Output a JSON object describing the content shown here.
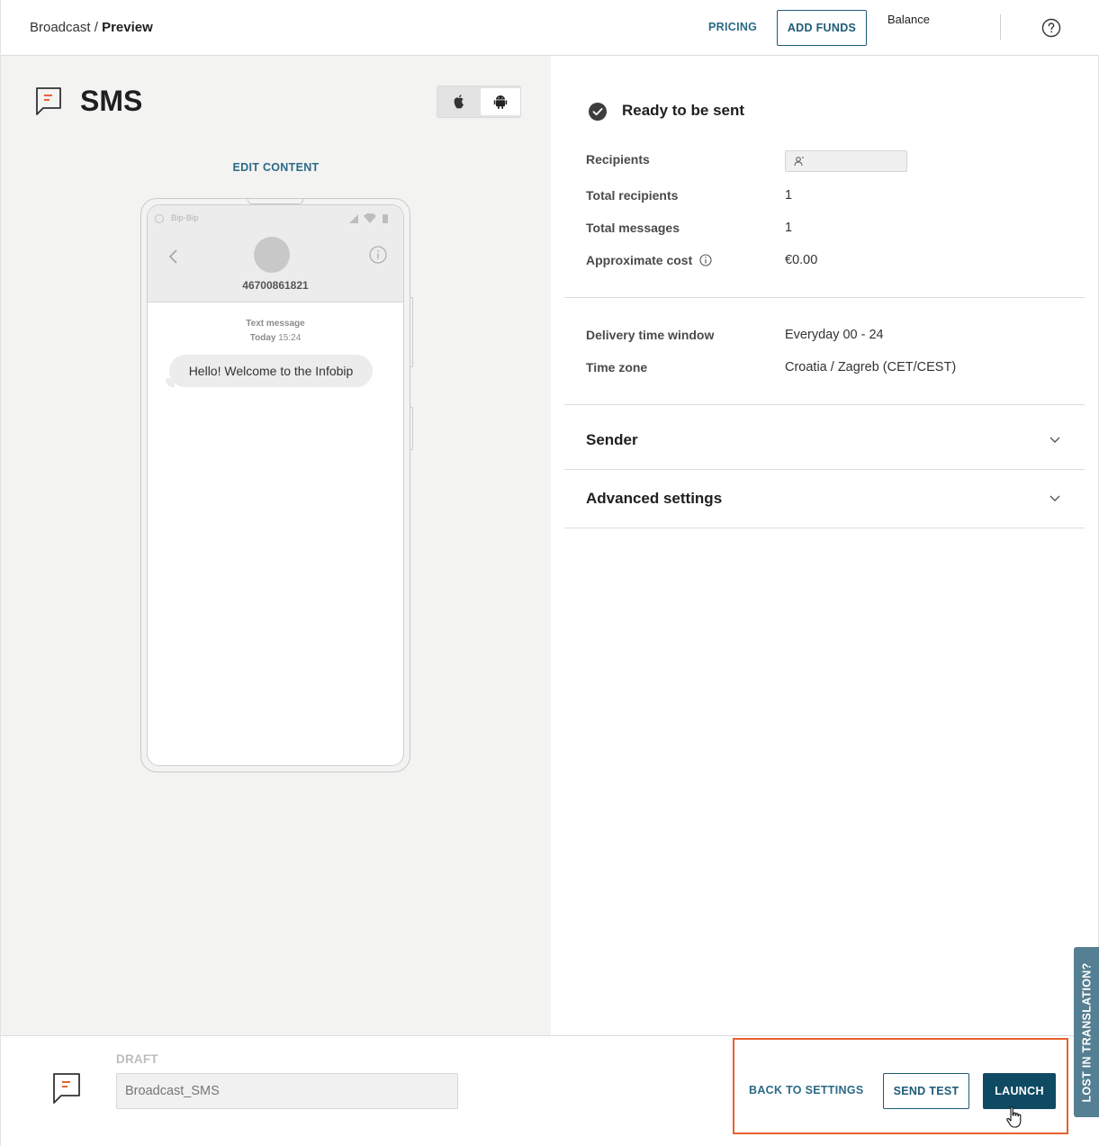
{
  "header": {
    "breadcrumb_parent": "Broadcast",
    "breadcrumb_sep": " / ",
    "breadcrumb_current": "Preview",
    "pricing_label": "PRICING",
    "add_funds_label": "ADD FUNDS",
    "balance_label": "Balance",
    "help_icon": "question-circle-icon"
  },
  "preview": {
    "channel_title": "SMS",
    "channel_icon": "sms-message-icon",
    "os_options": [
      "apple",
      "android"
    ],
    "os_selected": "android",
    "edit_content_label": "EDIT CONTENT",
    "phone": {
      "status_app_name": "Bip-Bip",
      "contact_number": "46700861821",
      "message_type": "Text message",
      "message_day": "Today",
      "message_time": "15:24",
      "message_text": "Hello! Welcome to the Infobip"
    }
  },
  "summary": {
    "status_text": "Ready to be sent",
    "status_icon": "check-circle-icon",
    "recipients_label": "Recipients",
    "total_recipients_label": "Total recipients",
    "total_recipients_value": "1",
    "total_messages_label": "Total messages",
    "total_messages_value": "1",
    "approx_cost_label": "Approximate cost",
    "approx_cost_value": "€0.00",
    "delivery_window_label": "Delivery time window",
    "delivery_window_value": "Everyday 00 - 24",
    "timezone_label": "Time zone",
    "timezone_value": "Croatia / Zagreb (CET/CEST)",
    "sender_section": "Sender",
    "advanced_section": "Advanced settings"
  },
  "footer": {
    "status_label": "DRAFT",
    "broadcast_name_placeholder": "Broadcast_SMS",
    "back_to_settings_label": "BACK TO SETTINGS",
    "send_test_label": "SEND TEST",
    "launch_label": "LAUNCH",
    "highlight_color": "#e8622f",
    "primary_color": "#0f4a63"
  },
  "feedback_tab": {
    "label": "LOST IN TRANSLATION?"
  }
}
